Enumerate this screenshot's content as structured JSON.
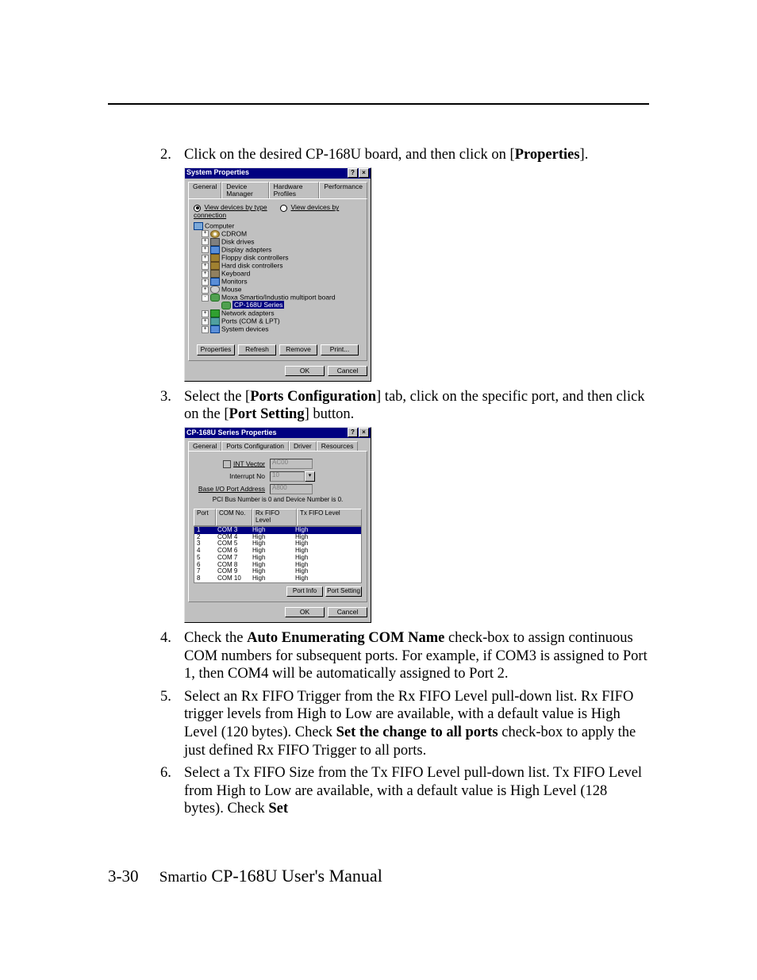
{
  "steps": {
    "s2": {
      "num": "2.",
      "pre": "Click on the desired CP-168U board, and then click on [",
      "bold": "Properties",
      "post": "]."
    },
    "s3": {
      "num": "3.",
      "pre": "Select the [",
      "b1": "Ports Configuration",
      "mid": "] tab, click on the specific port, and then click on the [",
      "b2": "Port Setting",
      "post": "] button."
    },
    "s4": {
      "num": "4.",
      "pre": "Check the ",
      "b1": "Auto Enumerating COM Name",
      "post": " check-box to assign continuous COM numbers for subsequent ports. For example, if COM3 is assigned to Port 1, then COM4 will be automatically assigned to Port 2."
    },
    "s5": {
      "num": "5.",
      "pre": "Select an Rx FIFO Trigger from the Rx FIFO Level pull-down list. Rx FIFO trigger levels from High to Low are available, with a default value is High Level (120 bytes). Check ",
      "b1": "Set the change to all ports",
      "post": " check-box to apply the just defined Rx FIFO Trigger to all ports."
    },
    "s6": {
      "num": "6.",
      "pre": "Select a Tx FIFO Size from the Tx FIFO Level pull-down list. Tx FIFO Level from High to Low are available, with a default value is High Level (128 bytes).  Check ",
      "b1": "Set"
    }
  },
  "dlg1": {
    "title": "System Properties",
    "help_btn": "?",
    "close_btn": "×",
    "tabs": [
      "General",
      "Device Manager",
      "Hardware Profiles",
      "Performance"
    ],
    "radio1": "View devices by type",
    "radio2": "View devices by connection",
    "tree": [
      {
        "lvl": 0,
        "icon": "ic-computer",
        "label": "Computer"
      },
      {
        "lvl": 1,
        "exp": "+",
        "icon": "ic-cd",
        "label": "CDROM"
      },
      {
        "lvl": 1,
        "exp": "+",
        "icon": "ic-disk",
        "label": "Disk drives"
      },
      {
        "lvl": 1,
        "exp": "+",
        "icon": "ic-disp",
        "label": "Display adapters"
      },
      {
        "lvl": 1,
        "exp": "+",
        "icon": "ic-floppy",
        "label": "Floppy disk controllers"
      },
      {
        "lvl": 1,
        "exp": "+",
        "icon": "ic-hdd",
        "label": "Hard disk controllers"
      },
      {
        "lvl": 1,
        "exp": "+",
        "icon": "ic-kb",
        "label": "Keyboard"
      },
      {
        "lvl": 1,
        "exp": "+",
        "icon": "ic-mon",
        "label": "Monitors"
      },
      {
        "lvl": 1,
        "exp": "+",
        "icon": "ic-mouse",
        "label": "Mouse"
      },
      {
        "lvl": 1,
        "exp": "-",
        "icon": "ic-moxa",
        "label": "Moxa Smartio/Industio multiport board"
      },
      {
        "lvl": 2,
        "icon": "ic-moxa",
        "label": "CP-168U Series",
        "selected": true
      },
      {
        "lvl": 1,
        "exp": "+",
        "icon": "ic-net",
        "label": "Network adapters"
      },
      {
        "lvl": 1,
        "exp": "+",
        "icon": "ic-port",
        "label": "Ports (COM & LPT)"
      },
      {
        "lvl": 1,
        "exp": "+",
        "icon": "ic-sys",
        "label": "System devices"
      }
    ],
    "buttons": [
      "Properties",
      "Refresh",
      "Remove",
      "Print..."
    ],
    "ok": "OK",
    "cancel": "Cancel"
  },
  "dlg2": {
    "title": "CP-168U Series Properties",
    "help_btn": "?",
    "close_btn": "×",
    "tabs": [
      "General",
      "Ports Configuration",
      "Driver",
      "Resources"
    ],
    "chk_label": "INT Vector",
    "int_vector_val": "AC00",
    "irq_label": "Interrupt No",
    "irq_val": "10",
    "base_label": "Base I/O Port Address",
    "base_val": "A800",
    "pci_note": "PCI Bus Number is 0 and Device Number is 0.",
    "cols": [
      "Port",
      "COM No.",
      "Rx FIFO Level",
      "Tx FIFO Level"
    ],
    "rows": [
      {
        "port": "1",
        "com": "COM 3",
        "rx": "High",
        "tx": "High",
        "sel": true
      },
      {
        "port": "2",
        "com": "COM 4",
        "rx": "High",
        "tx": "High"
      },
      {
        "port": "3",
        "com": "COM 5",
        "rx": "High",
        "tx": "High"
      },
      {
        "port": "4",
        "com": "COM 6",
        "rx": "High",
        "tx": "High"
      },
      {
        "port": "5",
        "com": "COM 7",
        "rx": "High",
        "tx": "High"
      },
      {
        "port": "6",
        "com": "COM 8",
        "rx": "High",
        "tx": "High"
      },
      {
        "port": "7",
        "com": "COM 9",
        "rx": "High",
        "tx": "High"
      },
      {
        "port": "8",
        "com": "COM 10",
        "rx": "High",
        "tx": "High"
      }
    ],
    "btn_info": "Port Info",
    "btn_setting": "Port Setting",
    "ok": "OK",
    "cancel": "Cancel"
  },
  "footer": {
    "page": "3-30",
    "smartio": "Smartio",
    "title": " CP-168U User's Manual"
  }
}
